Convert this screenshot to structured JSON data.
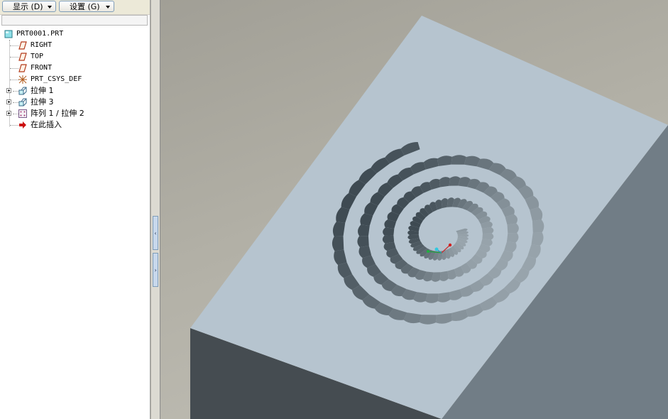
{
  "toolbar": {
    "show_label": "显示 (D)",
    "settings_label": "设置 (G)"
  },
  "tree": {
    "root": "PRT0001.PRT",
    "items": [
      {
        "label": "RIGHT",
        "icon": "datum-plane-icon"
      },
      {
        "label": "TOP",
        "icon": "datum-plane-icon"
      },
      {
        "label": "FRONT",
        "icon": "datum-plane-icon"
      },
      {
        "label": "PRT_CSYS_DEF",
        "icon": "coordinate-system-icon"
      },
      {
        "label": "拉伸 1",
        "icon": "extrude-feature-icon"
      },
      {
        "label": "拉伸 3",
        "icon": "extrude-feature-icon"
      },
      {
        "label": "阵列 1 / 拉伸 2",
        "icon": "pattern-feature-icon"
      },
      {
        "label": "在此插入",
        "icon": "insert-here-arrow-icon"
      }
    ]
  },
  "splitter": {
    "collapse_glyph": "‹",
    "expand_glyph": "›"
  },
  "colors": {
    "model_top": "#b6c4cf",
    "model_right": "#717d86",
    "model_front": "#454c51",
    "viewport_bg": "#b2b0a6",
    "insert_arrow": "#cc1010"
  }
}
